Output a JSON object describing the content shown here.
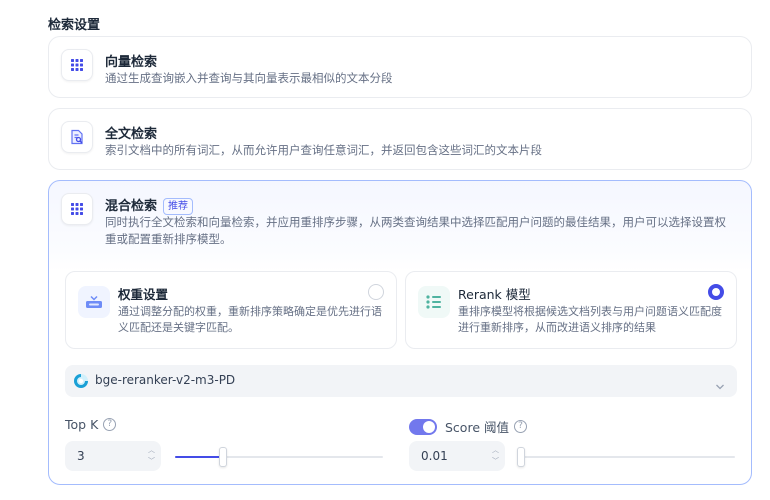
{
  "section_title": "检索设置",
  "vector": {
    "title": "向量检索",
    "desc": "通过生成查询嵌入并查询与其向量表示最相似的文本分段",
    "icon": "vector-search-icon"
  },
  "fulltext": {
    "title": "全文检索",
    "desc": "索引文档中的所有词汇，从而允许用户查询任意词汇，并返回包含这些词汇的文本片段",
    "icon": "fulltext-search-icon"
  },
  "hybrid": {
    "title": "混合检索",
    "badge": "推荐",
    "desc": "同时执行全文检索和向量检索，并应用重排序步骤，从两类查询结果中选择匹配用户问题的最佳结果，用户可以选择设置权重或配置重新排序模型。",
    "icon": "hybrid-search-icon",
    "weight_option": {
      "title": "权重设置",
      "desc": "通过调整分配的权重，重新排序策略确定是优先进行语义匹配还是关键字匹配。",
      "selected": false
    },
    "rerank_option": {
      "title": "Rerank 模型",
      "desc": "重排序模型将根据候选文档列表与用户问题语义匹配度进行重新排序，从而改进语义排序的结果",
      "selected": true
    },
    "model": {
      "name": "bge-reranker-v2-m3-PD"
    },
    "top_k": {
      "label": "Top K",
      "value": "3",
      "slider_fraction": 0.23
    },
    "score": {
      "label": "Score 阈值",
      "value": "0.01",
      "enabled": true,
      "slider_fraction": 0.01
    }
  },
  "colors": {
    "accent": "#444ce7",
    "selected_border": "#a4bcfd",
    "text_primary": "#1d2939",
    "text_secondary": "#667085"
  }
}
